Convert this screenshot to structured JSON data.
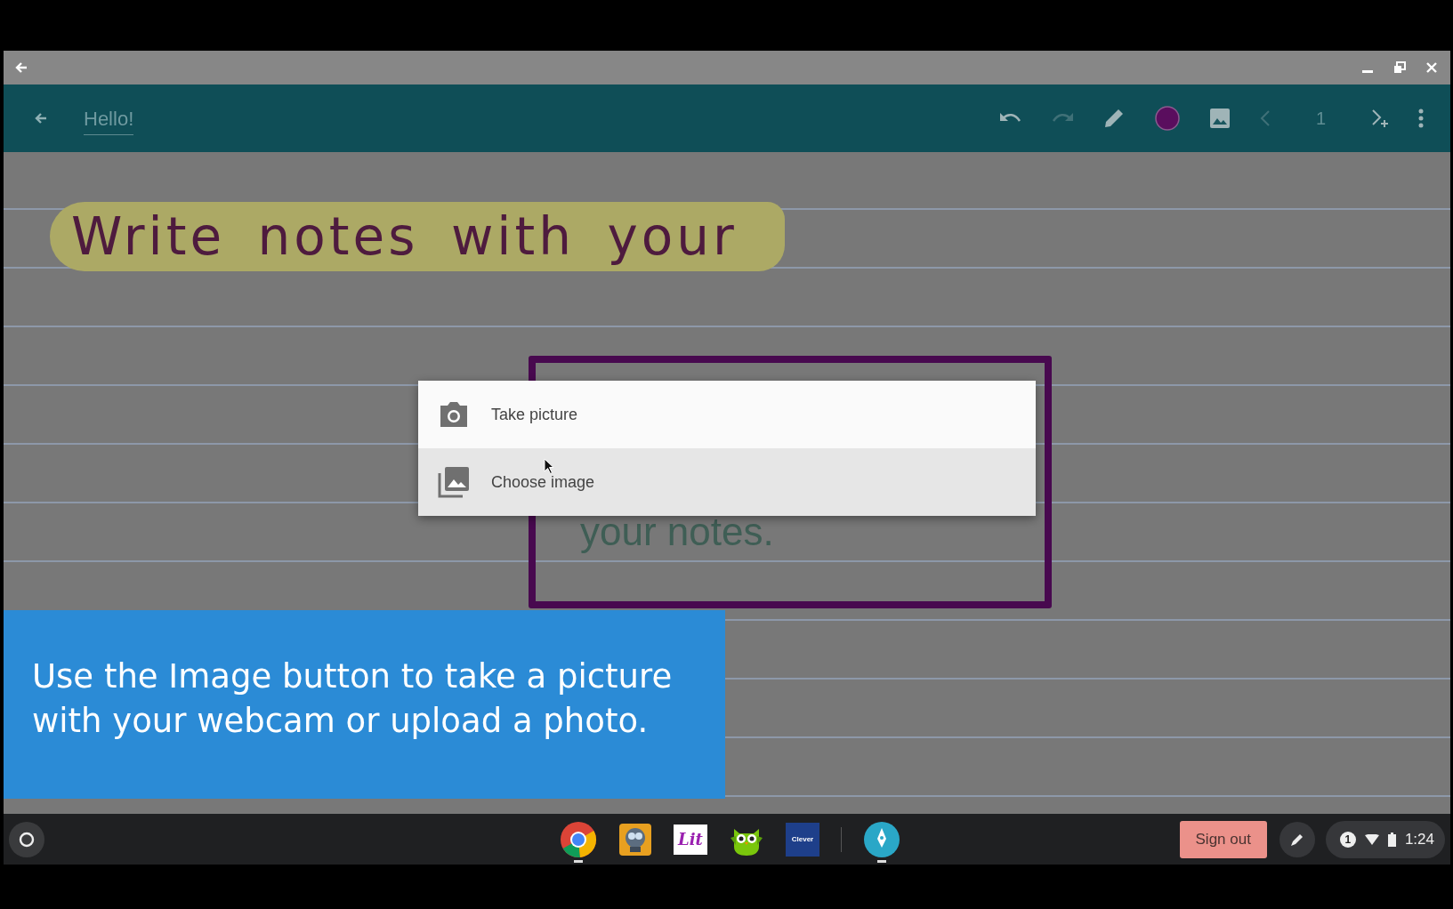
{
  "toolbar": {
    "title": "Hello!",
    "page": "1",
    "tools": [
      {
        "kind": "undo",
        "disabled": false
      },
      {
        "kind": "redo",
        "disabled": true
      },
      {
        "kind": "pen",
        "disabled": false
      },
      {
        "kind": "color",
        "disabled": false,
        "color": "#5a0e5e"
      },
      {
        "kind": "image",
        "disabled": false
      },
      {
        "kind": "prev",
        "disabled": true
      },
      {
        "kind": "page"
      },
      {
        "kind": "next-add",
        "disabled": false
      },
      {
        "kind": "more",
        "disabled": false
      }
    ]
  },
  "canvas": {
    "handwriting": "Write notes with your",
    "typed_text": "your notes."
  },
  "menu": {
    "items": [
      {
        "kind": "camera",
        "label": "Take picture",
        "highlighted": false
      },
      {
        "kind": "gallery",
        "label": "Choose image",
        "highlighted": true
      }
    ]
  },
  "caption": {
    "text": "Use the Image button to take a picture with your webcam or upload a photo."
  },
  "shelf": {
    "apps": [
      {
        "kind": "chrome",
        "running": true
      },
      {
        "kind": "robot",
        "running": false
      },
      {
        "kind": "lit",
        "label": "Lit",
        "running": false
      },
      {
        "kind": "owl",
        "running": false
      },
      {
        "kind": "clever",
        "label": "Clever",
        "running": false
      },
      {
        "kind": "divider"
      },
      {
        "kind": "pen",
        "running": true
      }
    ],
    "sign_out": "Sign out",
    "notifications": "1",
    "time": "1:24"
  }
}
